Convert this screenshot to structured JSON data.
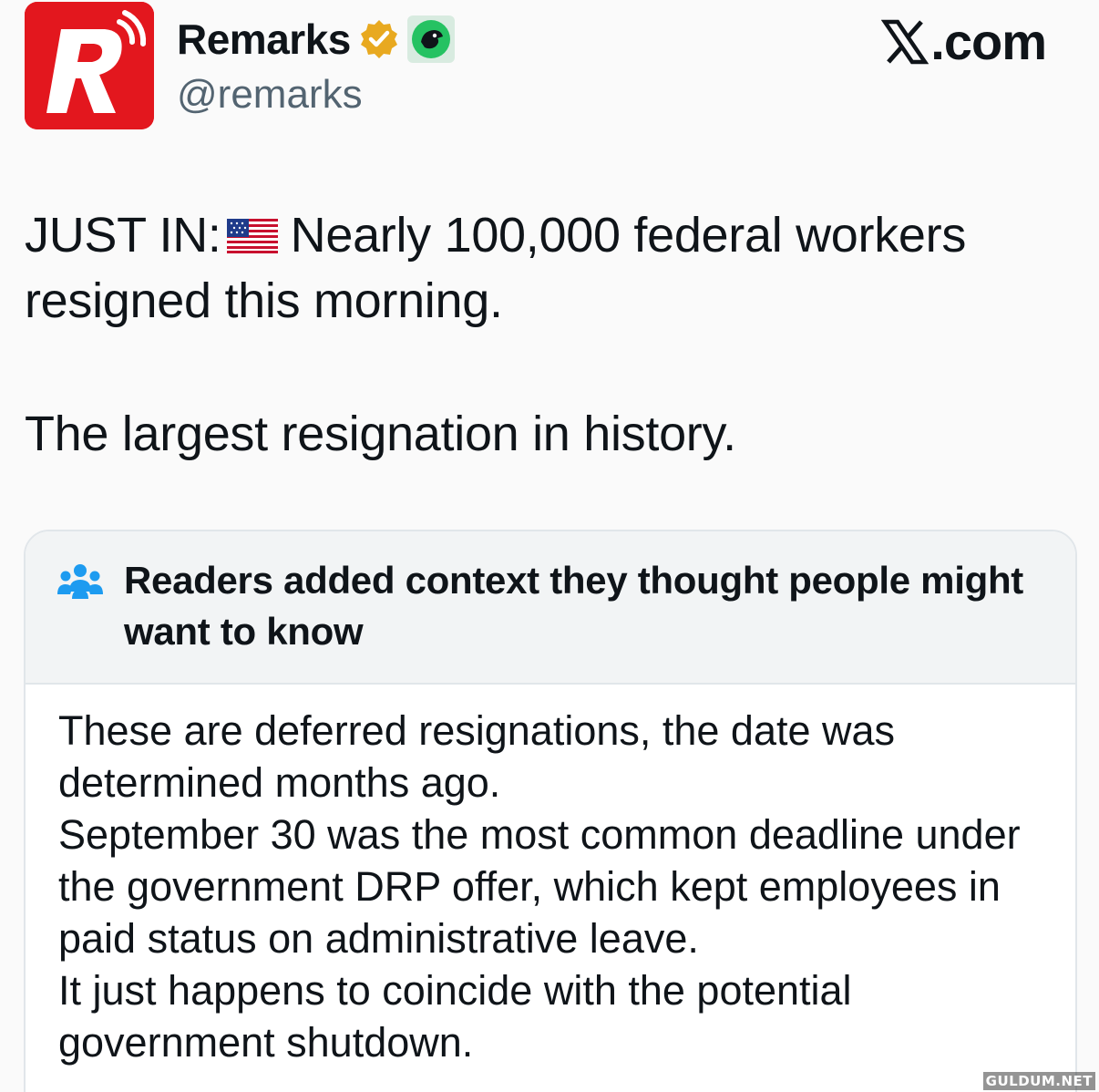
{
  "post": {
    "author": {
      "display_name": "Remarks",
      "handle": "@remarks",
      "avatar_icon": "remarks-r-logo",
      "verified_icon": "gold-verified-badge",
      "affiliate_icon": "affiliate-badge-icon"
    },
    "platform": {
      "brand_text": ".com",
      "brand_icon": "x-logo-icon"
    },
    "text": {
      "line1_prefix": "JUST IN:",
      "flag_icon": "us-flag-emoji",
      "line1_rest": "Nearly 100,000 federal workers resigned this morning.",
      "line2": "The largest resignation in history."
    }
  },
  "community_note": {
    "header_icon": "people-group-icon",
    "header_title": "Readers added context they thought people might want to know",
    "paragraph1": "These are deferred resignations, the date was determined months ago.",
    "paragraph2": "September 30 was the most common deadline under the government DRP offer, which kept employees in paid status on administrative leave.",
    "paragraph3": "It just happens to coincide with the potential government shutdown."
  },
  "watermark": {
    "text": "GULDUM.NET"
  },
  "colors": {
    "avatar_bg": "#e3171e",
    "verified_gold": "#e8a920",
    "note_icon_blue": "#1d9bf0",
    "handle_gray": "#536471"
  }
}
